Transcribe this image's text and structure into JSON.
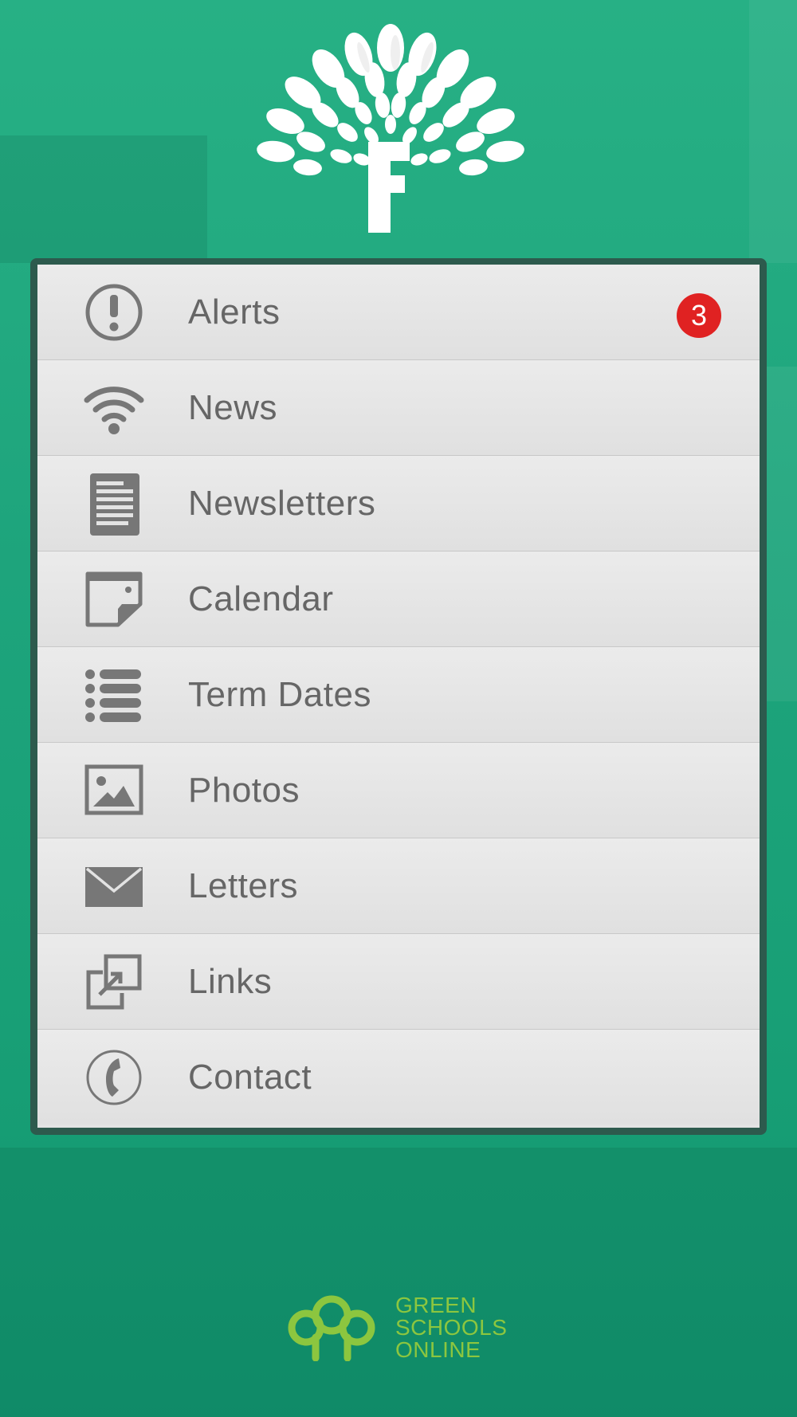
{
  "app": {
    "logo_letter": "F"
  },
  "menu": {
    "items": [
      {
        "label": "Alerts",
        "icon": "alert-icon",
        "badge": "3"
      },
      {
        "label": "News",
        "icon": "wifi-icon"
      },
      {
        "label": "Newsletters",
        "icon": "document-icon"
      },
      {
        "label": "Calendar",
        "icon": "calendar-note-icon"
      },
      {
        "label": "Term Dates",
        "icon": "list-icon"
      },
      {
        "label": "Photos",
        "icon": "image-icon"
      },
      {
        "label": "Letters",
        "icon": "envelope-icon"
      },
      {
        "label": "Links",
        "icon": "external-link-icon"
      },
      {
        "label": "Contact",
        "icon": "phone-icon"
      }
    ]
  },
  "footer": {
    "brand_line1": "GREEN",
    "brand_line2": "SCHOOLS",
    "brand_line3": "ONLINE"
  },
  "colors": {
    "background": "#1fa67c",
    "panel_border": "#2d5a4d",
    "item_text": "#666666",
    "badge": "#e02222",
    "brand_green": "#8cc63f"
  }
}
